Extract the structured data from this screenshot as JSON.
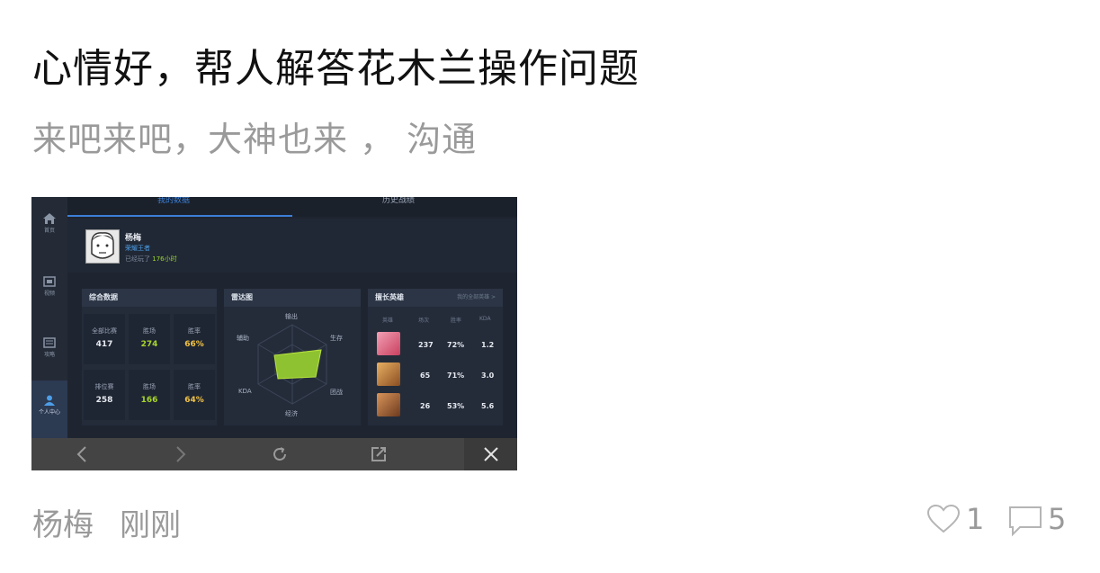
{
  "post": {
    "title": "心情好，帮人解答花木兰操作问题",
    "subtitle": "来吧来吧，大神也来 ， 沟通",
    "author": "杨梅",
    "time": "刚刚",
    "likes": "1",
    "comments": "5"
  },
  "screenshot": {
    "nav": [
      "首页",
      "视频",
      "攻略",
      "个人中心"
    ],
    "tabs": {
      "current": "我的数据",
      "history": "历史战绩"
    },
    "profile": {
      "name": "杨梅",
      "rank": "荣耀王者",
      "time_prefix": "已经玩了",
      "time_value": "176小时"
    },
    "overview": {
      "title": "综合数据",
      "cells": [
        {
          "label": "全部比赛",
          "value": "417",
          "color": "white"
        },
        {
          "label": "胜场",
          "value": "274",
          "color": "green"
        },
        {
          "label": "胜率",
          "value": "66%",
          "color": "yellow"
        },
        {
          "label": "排位赛",
          "value": "258",
          "color": "white"
        },
        {
          "label": "胜场",
          "value": "166",
          "color": "green"
        },
        {
          "label": "胜率",
          "value": "64%",
          "color": "yellow"
        }
      ]
    },
    "radar": {
      "title": "雷达图",
      "labels": {
        "top": "输出",
        "top_right": "生存",
        "right": "团战",
        "bottom": "经济",
        "left": "KDA",
        "top_left": "辅助"
      }
    },
    "heroes": {
      "title": "擅长英雄",
      "link": "我的全部英雄 >",
      "headers": [
        "英雄",
        "场次",
        "胜率",
        "KDA"
      ],
      "rows": [
        {
          "games": "237",
          "winrate": "72%",
          "kda": "1.2",
          "color": "#e8738f"
        },
        {
          "games": "65",
          "winrate": "71%",
          "kda": "3.0",
          "color": "#c9853f"
        },
        {
          "games": "26",
          "winrate": "53%",
          "kda": "5.6",
          "color": "#b96a3a"
        }
      ]
    },
    "accent_color": "#3b7fd6"
  }
}
